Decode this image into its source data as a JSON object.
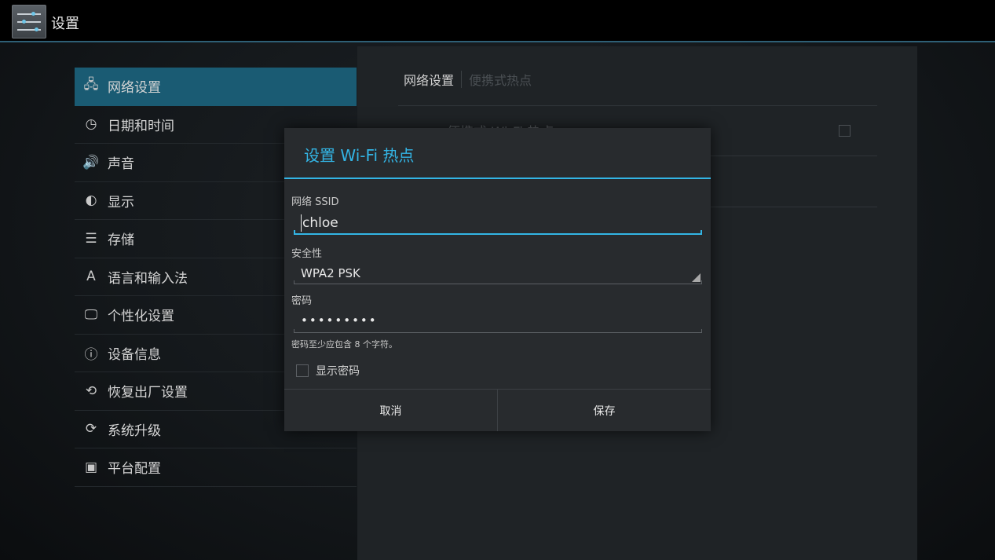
{
  "actionbar": {
    "title": "设置",
    "app_icon": "settings-sliders-icon"
  },
  "nav": {
    "items": [
      {
        "label": "网络设置",
        "icon": "network-icon",
        "glyph": "🖧",
        "selected": true
      },
      {
        "label": "日期和时间",
        "icon": "clock-icon",
        "glyph": "◷"
      },
      {
        "label": "声音",
        "icon": "speaker-icon",
        "glyph": "🔊"
      },
      {
        "label": "显示",
        "icon": "brightness-icon",
        "glyph": "◐"
      },
      {
        "label": "存储",
        "icon": "storage-icon",
        "glyph": "☰"
      },
      {
        "label": "语言和输入法",
        "icon": "language-icon",
        "glyph": "A"
      },
      {
        "label": "个性化设置",
        "icon": "monitor-icon",
        "glyph": "🖵"
      },
      {
        "label": "设备信息",
        "icon": "info-icon",
        "glyph": "ⓘ"
      },
      {
        "label": "恢复出厂设置",
        "icon": "restore-icon",
        "glyph": "⟲"
      },
      {
        "label": "系统升级",
        "icon": "update-icon",
        "glyph": "⟳"
      },
      {
        "label": "平台配置",
        "icon": "image-icon",
        "glyph": "▣"
      }
    ]
  },
  "panel": {
    "tab_active": "网络设置",
    "tab_inactive": "便携式热点",
    "row_label": "便携式 Wi-Fi 热点"
  },
  "dialog": {
    "title": "设置 Wi-Fi 热点",
    "ssid_label": "网络 SSID",
    "ssid_value": "chloe",
    "security_label": "安全性",
    "security_value": "WPA2 PSK",
    "password_label": "密码",
    "password_value": "•••••••••",
    "hint": "密码至少应包含 8 个字符。",
    "show_password_label": "显示密码",
    "cancel_label": "取消",
    "save_label": "保存"
  },
  "colors": {
    "accent": "#33b5e5",
    "selected_nav": "#1a5b73"
  }
}
